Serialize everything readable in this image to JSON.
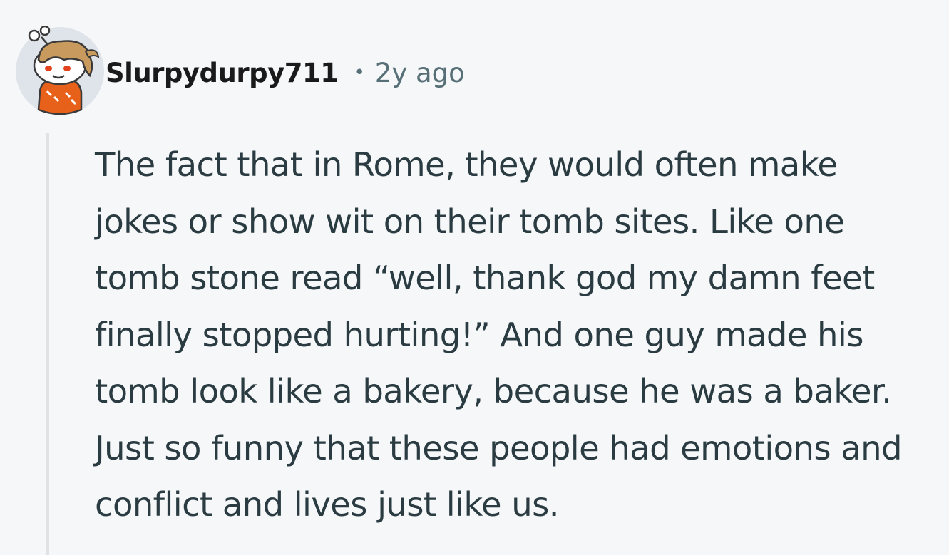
{
  "comment": {
    "author": "Slurpydurpy711",
    "separator": "•",
    "timestamp": "2y ago",
    "body": "The fact that in Rome, they would often make jokes or show wit on their tomb sites. Like one tomb stone read “well, thank god my damn feet finally stopped hurting!” And one guy made his tomb look like a bakery, because he was a baker. Just so funny that these people had emotions and conflict and lives just like us."
  },
  "colors": {
    "background": "#f6f7f9",
    "author": "#1a1a1b",
    "meta": "#576f76",
    "body_text": "#2a3c42",
    "thread_line": "#dfe3e6",
    "avatar_bg": "#dfe4ea",
    "avatar_hair": "#c99a5e",
    "avatar_shirt": "#e8611a"
  }
}
